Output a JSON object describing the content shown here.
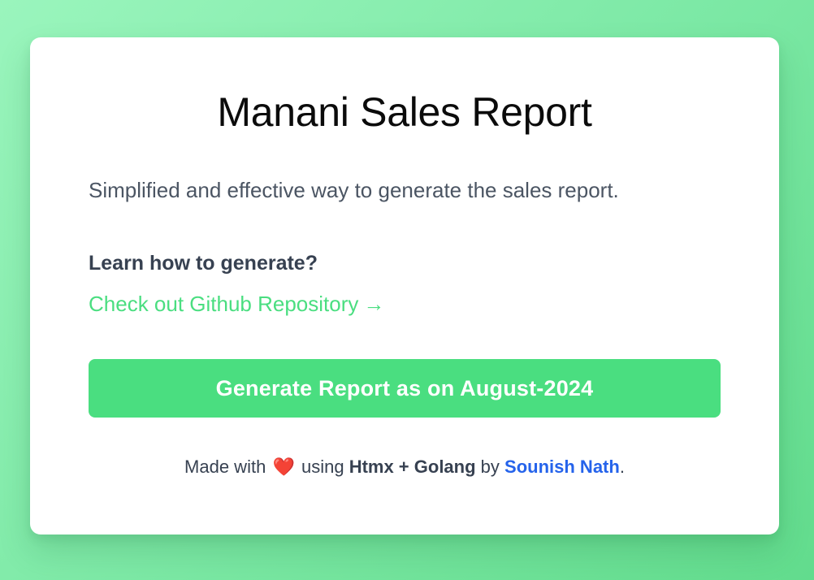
{
  "card": {
    "title": "Manani Sales Report",
    "subtitle": "Simplified and effective way to generate the sales report.",
    "learn_heading": "Learn how to generate?",
    "repo_link_label": "Check out Github Repository",
    "repo_link_arrow": "→",
    "generate_button_label": "Generate Report as on August-2024"
  },
  "footer": {
    "made_with": "Made with",
    "heart_icon": "❤️",
    "using": "using",
    "tech": "Htmx + Golang",
    "by": "by",
    "author": "Sounish Nath",
    "period": "."
  },
  "colors": {
    "background_accent": "#62dc8d",
    "button": "#4ade80",
    "link_green": "#4ade80",
    "author_link": "#2563eb"
  }
}
